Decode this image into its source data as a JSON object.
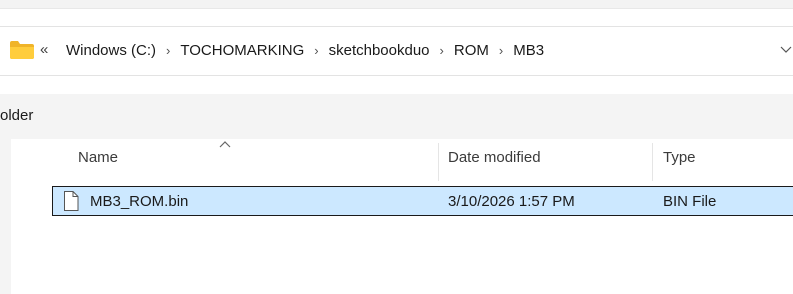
{
  "address_bar": {
    "overflow_glyph": "«",
    "breadcrumbs": [
      "Windows (C:)",
      "TOCHOMARKING",
      "sketchbookduo",
      "ROM",
      "MB3"
    ],
    "separator": "›"
  },
  "command_bar": {
    "visible_text": "older"
  },
  "file_list": {
    "columns": {
      "name": "Name",
      "date_modified": "Date modified",
      "type": "Type"
    },
    "sorted_by": "Name",
    "rows": [
      {
        "name": "MB3_ROM.bin",
        "date_modified": "3/10/2026 1:57 PM",
        "type": "BIN File",
        "selected": true
      }
    ]
  },
  "colors": {
    "folder": "#f0b429",
    "selection": "#cce8ff",
    "nav_pane": "#f4f4f4"
  },
  "icons": {
    "location": "folder-icon",
    "file": "document-icon"
  }
}
